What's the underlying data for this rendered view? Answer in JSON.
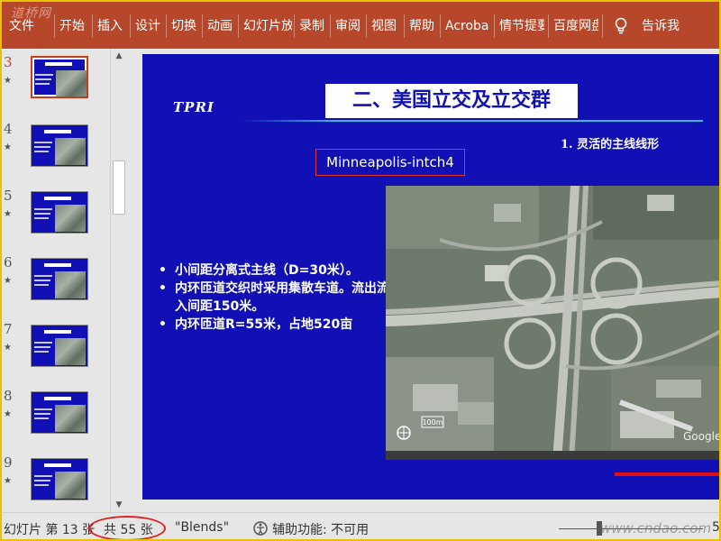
{
  "ribbon": {
    "tabs": [
      "文件",
      "开始",
      "插入",
      "设计",
      "切换",
      "动画",
      "幻灯片放",
      "录制",
      "审阅",
      "视图",
      "帮助",
      "Acroba",
      "情节提要",
      "百度网盘"
    ],
    "tell_me": "告诉我",
    "watermark": "道桥网"
  },
  "thumbnails": [
    {
      "number": "3",
      "active": true
    },
    {
      "number": "4",
      "active": false
    },
    {
      "number": "5",
      "active": false
    },
    {
      "number": "6",
      "active": false
    },
    {
      "number": "7",
      "active": false
    },
    {
      "number": "8",
      "active": false
    },
    {
      "number": "9",
      "active": false
    }
  ],
  "slide": {
    "logo": "TPRI",
    "title": "二、美国立交及立交群",
    "subheading": "1. 灵活的主线线形",
    "site_label": "Minneapolis-intch4",
    "bullets": [
      "小间距分离式主线（D=30米）。",
      "内环匝道交织时采用集散车道。流出流入间距150米。",
      "内环匝道R=55米，占地520亩"
    ],
    "map_brand": "Google",
    "map_scale": "100m"
  },
  "status_bar": {
    "slide_position": "幻灯片 第 13 张",
    "total": "共 55 张",
    "theme": "\"Blends\"",
    "accessibility": "辅助功能: 不可用",
    "watermark": "www.cndao.com",
    "zoom_value": "5"
  },
  "colors": {
    "ribbon": "#b7472a",
    "slide_bg": "#1010b4",
    "highlight_ellipse": "#e02020",
    "frame": "#e8c400"
  }
}
